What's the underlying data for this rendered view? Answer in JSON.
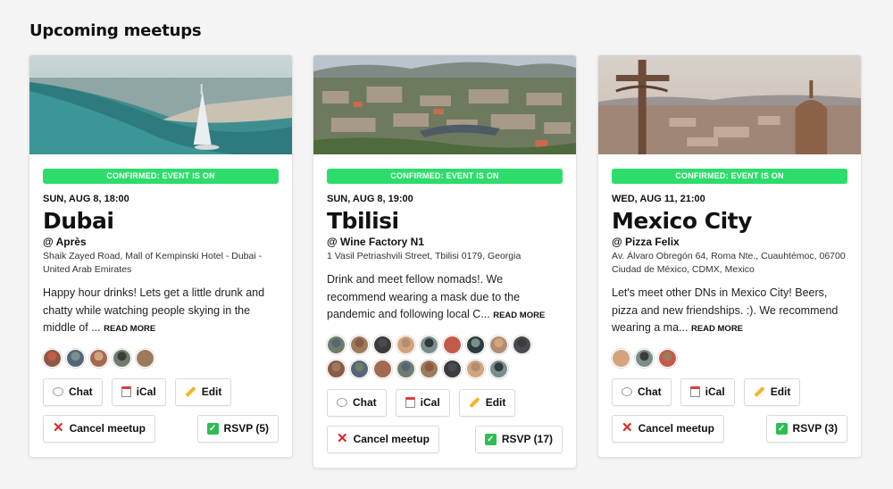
{
  "page": {
    "title": "Upcoming meetups"
  },
  "colors": {
    "status_green": "#2ddd6c",
    "cancel_red": "#e02121",
    "rsvp_green": "#2ebd52"
  },
  "buttons": {
    "chat": "Chat",
    "ical": "iCal",
    "edit": "Edit",
    "cancel": "Cancel meetup"
  },
  "cards": [
    {
      "status": "CONFIRMED: EVENT IS ON",
      "date": "SUN, AUG 8, 18:00",
      "city": "Dubai",
      "venue": "@ Après",
      "address": "Shaik Zayed Road, Mall of Kempinski Hotel - Dubai - United Arab Emirates",
      "description": "Happy hour drinks! Lets get a little drunk and chatty while watching people skying in the middle of ...",
      "read_more": "READ MORE",
      "rsvp": "RSVP (5)",
      "attendee_count": 5
    },
    {
      "status": "CONFIRMED: EVENT IS ON",
      "date": "SUN, AUG 8, 19:00",
      "city": "Tbilisi",
      "venue": "@ Wine Factory N1",
      "address": "1 Vasil Petriashvili Street, Tbilisi 0179, Georgia",
      "description": "Drink and meet fellow nomads!. We recommend wearing a mask due to the pandemic and following local C...",
      "read_more": "READ MORE",
      "rsvp": "RSVP (17)",
      "attendee_count": 17
    },
    {
      "status": "CONFIRMED: EVENT IS ON",
      "date": "WED, AUG 11, 21:00",
      "city": "Mexico City",
      "venue": "@ Pizza Felix",
      "address": "Av. Álvaro Obregón 64, Roma Nte., Cuauhtémoc, 06700 Ciudad de México, CDMX, Mexico",
      "description": "Let's meet other DNs in Mexico City! Beers, pizza and new friendships. :). We recommend wearing a ma...",
      "read_more": "READ MORE",
      "rsvp": "RSVP (3)",
      "attendee_count": 3
    }
  ]
}
